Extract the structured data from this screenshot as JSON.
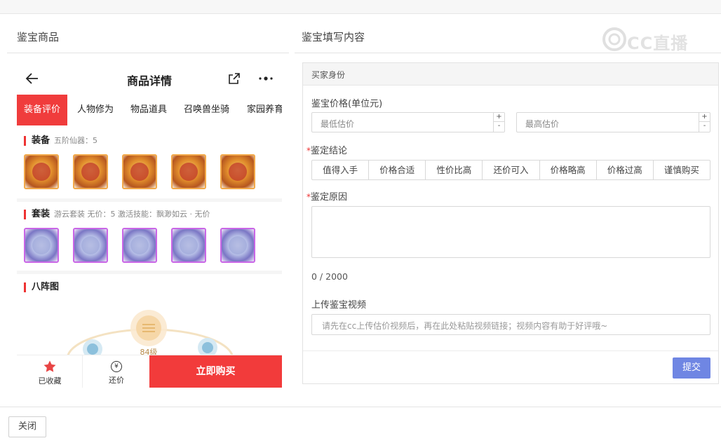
{
  "left_panel": {
    "title": "鉴宝商品"
  },
  "right_panel": {
    "title": "鉴宝填写内容"
  },
  "watermark": {
    "text": "CC直播"
  },
  "phone": {
    "header_title": "商品详情",
    "tabs": [
      "装备评价",
      "人物修为",
      "物品道具",
      "召唤兽坐骑",
      "家园养育"
    ],
    "equipment": {
      "title": "装备",
      "subtitle": "五阶仙器：5"
    },
    "set": {
      "title": "套装",
      "subtitle": "游云套装   无价：5   激活技能：飘渺如云 · 无价"
    },
    "formation": {
      "title": "八阵图",
      "level": "84级"
    },
    "bottom": {
      "favorite_label": "已收藏",
      "bargain_icon": "¥",
      "bargain_label": "还价",
      "buy_label": "立即购买"
    }
  },
  "form": {
    "header": "买家身份",
    "price_label": "鉴宝价格(单位元)",
    "min_placeholder": "最低估价",
    "max_placeholder": "最高估价",
    "spin_up": "+",
    "spin_down": "-",
    "required_mark": "*",
    "conclusion_label": "鉴定结论",
    "conclusion_options": [
      "值得入手",
      "价格合适",
      "性价比高",
      "还价可入",
      "价格略高",
      "价格过高",
      "谨慎购买"
    ],
    "reason_label": "鉴定原因",
    "char_count": "0 / 2000",
    "video_label": "上传鉴宝视频",
    "video_placeholder": "请先在cc上传估价视频后，再在此处粘贴视频链接；视频内容有助于好评哦~",
    "submit_label": "提交"
  },
  "footer": {
    "close_label": "关闭"
  },
  "colors": {
    "accent_red": "#f23b3b",
    "submit_blue": "#6f86e3"
  }
}
